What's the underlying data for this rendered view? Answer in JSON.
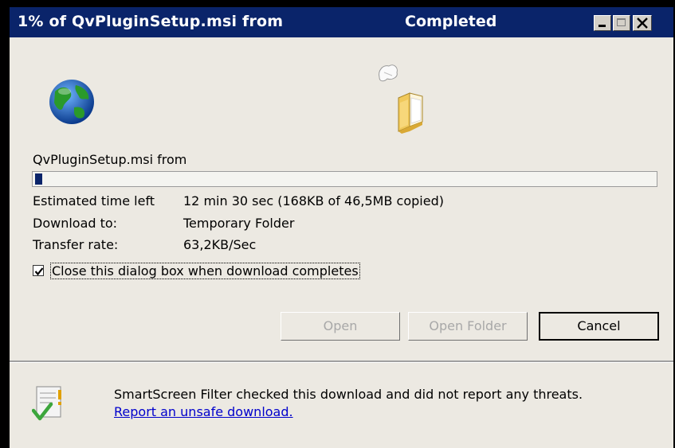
{
  "window": {
    "title": "1% of QvPluginSetup.msi from",
    "status": "Completed"
  },
  "download": {
    "file_label": "QvPluginSetup.msi from",
    "progress_percent": 1,
    "rows": [
      {
        "label": "Estimated time left",
        "value": "12 min 30 sec (168KB of 46,5MB copied)"
      },
      {
        "label": "Download to:",
        "value": "Temporary Folder"
      },
      {
        "label": "Transfer rate:",
        "value": "63,2KB/Sec"
      }
    ],
    "close_when_done": {
      "checked": true,
      "label": "Close this dialog box when download completes"
    }
  },
  "buttons": {
    "open": "Open",
    "open_folder": "Open Folder",
    "cancel": "Cancel"
  },
  "smartscreen": {
    "message": "SmartScreen Filter checked this download and did not report any threats.",
    "link": "Report an unsafe download."
  },
  "icons": {
    "globe": "globe-icon",
    "folder": "folder-icon",
    "paper": "paper-icon",
    "shield": "smartscreen-check-icon"
  },
  "colors": {
    "titlebar": "#0a246a",
    "progress_fill": "#0a246a",
    "link": "#0000cc",
    "dialog_bg": "#ece9e2"
  }
}
